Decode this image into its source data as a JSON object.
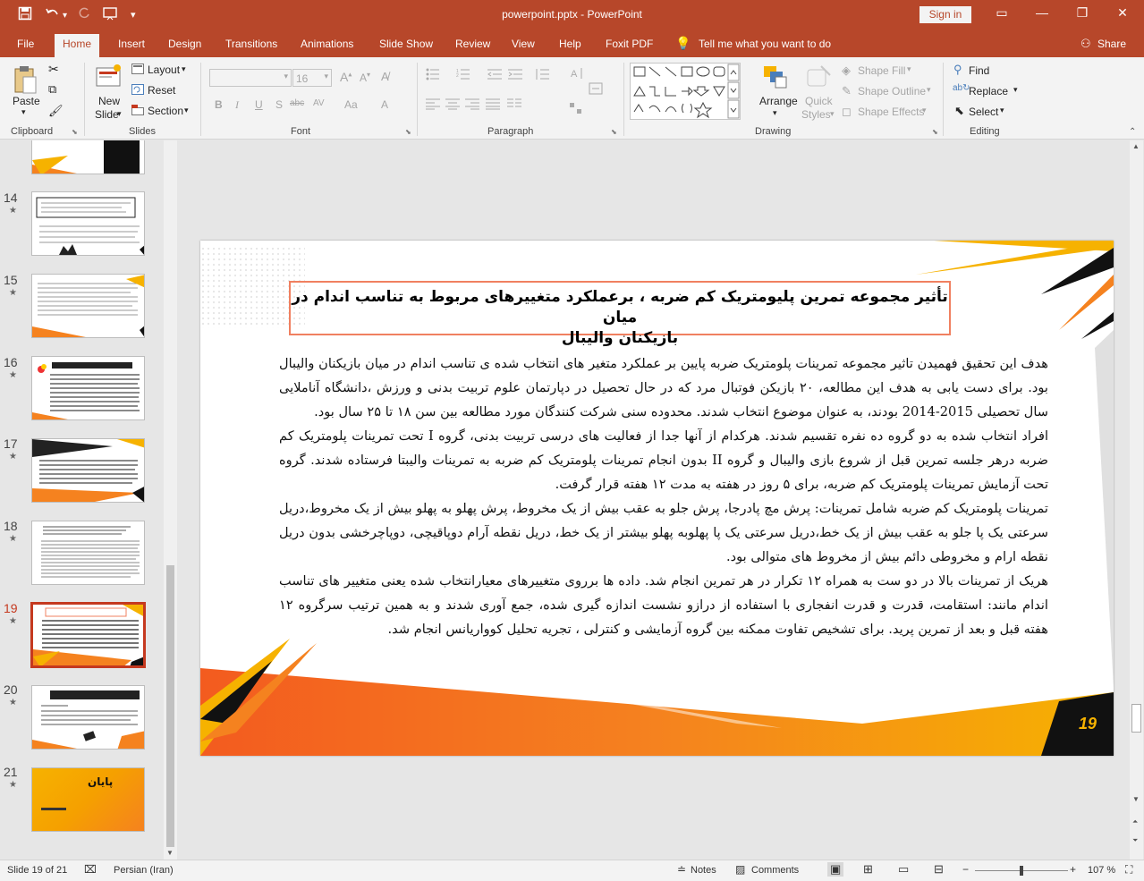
{
  "titlebar": {
    "title": "powerpoint.pptx  -  PowerPoint",
    "signin": "Sign in",
    "save_icon": "save-icon",
    "undo_icon": "undo-icon",
    "redo_icon": "redo-icon",
    "present_icon": "start-from-beginning-icon",
    "customize_icon": "customize-quick-access-icon"
  },
  "tabs": [
    "File",
    "Home",
    "Insert",
    "Design",
    "Transitions",
    "Animations",
    "Slide Show",
    "Review",
    "View",
    "Help",
    "Foxit PDF"
  ],
  "tell_me": "Tell me what you want to do",
  "share": "Share",
  "ribbon": {
    "clipboard": {
      "label": "Clipboard",
      "paste": "Paste"
    },
    "slides": {
      "label": "Slides",
      "new_slide_1": "New",
      "new_slide_2": "Slide",
      "layout": "Layout",
      "reset": "Reset",
      "section": "Section"
    },
    "font": {
      "label": "Font",
      "size": "16",
      "bold": "B",
      "italic": "I",
      "underline": "U",
      "shadow": "S",
      "strike": "abc",
      "spacing": "AV",
      "case": "Aa",
      "color": "A"
    },
    "paragraph": {
      "label": "Paragraph"
    },
    "drawing": {
      "label": "Drawing",
      "arrange": "Arrange",
      "quick_1": "Quick",
      "quick_2": "Styles",
      "shape_fill": "Shape Fill",
      "shape_outline": "Shape Outline",
      "shape_effects": "Shape Effects"
    },
    "editing": {
      "label": "Editing",
      "find": "Find",
      "replace": "Replace",
      "select": "Select"
    }
  },
  "thumbnails": [
    {
      "num": "14"
    },
    {
      "num": "15"
    },
    {
      "num": "16"
    },
    {
      "num": "17"
    },
    {
      "num": "18"
    },
    {
      "num": "19",
      "active": true
    },
    {
      "num": "20"
    },
    {
      "num": "21",
      "text": "پایان"
    }
  ],
  "slide": {
    "title_line1": "تأثیر مجموعه تمرین پلیومتریک کم ضربه ، برعملکرد  متغییرهای مربوط به تناسب اندام در میان",
    "title_line2": "بازیکنان والیبال",
    "body": "هدف  این تحقیق فهمیدن تاثیر مجموعه تمرینات پلومتریک ضربه پایین بر عملکرد متغیر های انتخاب شده ی تناسب اندام در میان بازیکنان والیبال بود. برای دست یابی به هدف این مطالعه، ۲۰ بازیکن فوتبال مرد که در حال تحصیل در دپارتمان علوم تربیت بدنی و ورزش ،دانشگاه آناملایی سال تحصیلی 2015-2014 بودند، به عنوان موضوع انتخاب شدند. محدوده سنی شرکت کنندگان مورد مطالعه بین سن ۱۸ تا ۲۵ سال بود.",
    "body2": "افراد انتخاب شده به دو گروه ده نفره تقسیم شدند. هرکدام از آنها جدا از فعالیت های درسی تربیت بدنی، گروه I تحت تمرینات پلومتریک کم ضربه درهر جلسه تمرین قبل از شروع بازی والیبال و گروه II بدون انجام تمرینات پلومتریک کم ضربه به تمرینات والیبتا فرستاده شدند. گروه تحت آزمایش تمرینات پلومتریک کم ضربه، برای ۵ روز در هفته به مدت ۱۲ هفته قرار گرفت.",
    "body3": "تمرینات پلومتریک کم ضربه شامل تمرینات: پرش مچ پادرجا، پرش جلو به عقب بیش از یک مخروط، پرش پهلو به پهلو بیش از یک مخروط،دریل سرعتی یک پا جلو به عقب بیش از یک خط،دریل سرعتی یک پا پهلوبه پهلو بیشتر از یک خط، دریل نقطه آرام دوپاقیچی، دوپاچرخشی بدون دریل نقطه ارام و مخروطی دائم بیش از مخروط های متوالی بود.",
    "body4": "هریک از تمرینات بالا در دو ست به همراه ۱۲ تکرار در هر تمرین انجام شد. داده ها برروی متغییرهای معیارانتخاب شده یعنی متغییر های تناسب اندام مانند: استقامت، قدرت و قدرت انفجاری با استفاده از درازو نشست اندازه گیری  شده، جمع آوری شدند و به همین ترتیب سرگروه ۱۲ هفته قبل و بعد از تمرین پرید. برای تشخیص تفاوت ممکنه بین گروه آزمایشی و کنترلی ، تجریه تحلیل کوواریانس انجام شد.",
    "page_number": "19"
  },
  "status": {
    "slide_info": "Slide 19 of 21",
    "language": "Persian (Iran)",
    "notes": "Notes",
    "comments": "Comments",
    "zoom": "107 %"
  },
  "colors": {
    "accent": "#b7472a",
    "orange": "#f5821f",
    "yellow": "#f6b200"
  }
}
